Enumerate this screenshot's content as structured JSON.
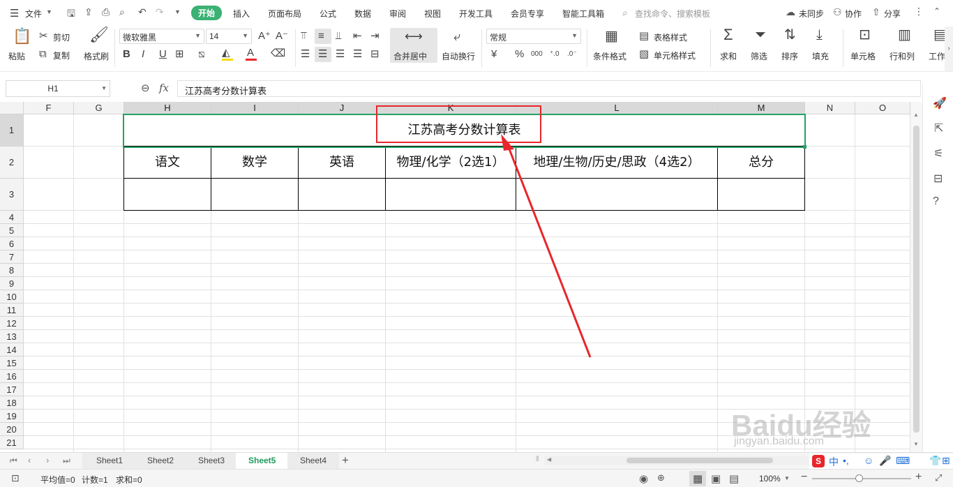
{
  "menubar": {
    "file": "文件",
    "tabs": [
      "开始",
      "插入",
      "页面布局",
      "公式",
      "数据",
      "审阅",
      "视图",
      "开发工具",
      "会员专享",
      "智能工具箱"
    ],
    "active_tab": "开始",
    "search_placeholder": "查找命令、搜索模板",
    "sync": "未同步",
    "collab": "协作",
    "share": "分享"
  },
  "ribbon": {
    "paste": "粘贴",
    "cut": "剪切",
    "copy": "复制",
    "format_painter": "格式刷",
    "font_name": "微软雅黑",
    "font_size": "14",
    "merge_center": "合并居中",
    "wrap_text": "自动换行",
    "number_format": "常规",
    "conditional_format": "条件格式",
    "table_style": "表格样式",
    "cell_style": "单元格样式",
    "sum": "求和",
    "filter": "筛选",
    "sort": "排序",
    "fill": "填充",
    "cells": "单元格",
    "rows_cols": "行和列",
    "worksheet": "工作",
    "bold": "B",
    "italic": "I",
    "underline": "U",
    "font_color_letter": "A",
    "currency": "¥",
    "percent": "%",
    "thousands": "000"
  },
  "formula_bar": {
    "name_box": "H1",
    "fx": "fx",
    "content": "江苏高考分数计算表"
  },
  "columns": [
    "F",
    "G",
    "H",
    "I",
    "J",
    "K",
    "L",
    "M",
    "N",
    "O"
  ],
  "rows": [
    "1",
    "2",
    "3",
    "4",
    "5",
    "6",
    "7",
    "8",
    "9",
    "10",
    "11",
    "12",
    "13",
    "14",
    "15",
    "16",
    "17",
    "18",
    "19",
    "20",
    "21"
  ],
  "sheet": {
    "title": "江苏高考分数计算表",
    "headers": [
      "语文",
      "数学",
      "英语",
      "物理/化学（2选1）",
      "地理/生物/历史/思政（4选2）",
      "总分"
    ]
  },
  "tabs": {
    "sheets": [
      "Sheet1",
      "Sheet2",
      "Sheet3",
      "Sheet5",
      "Sheet4"
    ],
    "active": "Sheet5",
    "add": "+"
  },
  "status": {
    "average": "平均值=0",
    "count": "计数=1",
    "sum": "求和=0",
    "zoom": "100%"
  },
  "watermark": {
    "brand": "Baidu经验",
    "url": "jingyan.baidu.com"
  },
  "colors": {
    "accent_green": "#3bb174",
    "selection_green": "#21a366",
    "annotation_red": "#e8262b"
  }
}
